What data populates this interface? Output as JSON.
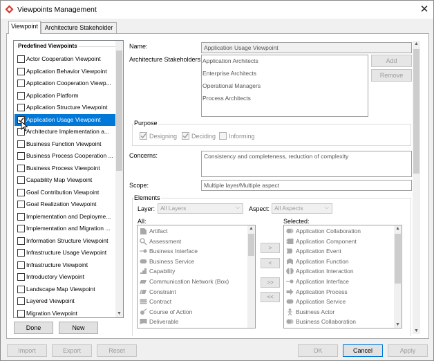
{
  "window": {
    "title": "Viewpoints Management",
    "close_glyph": "✕"
  },
  "tabs": [
    {
      "label": "Viewpoint"
    },
    {
      "label": "Architecture Stakeholder"
    }
  ],
  "predefined": {
    "heading": "Predefined Viewpoints",
    "items": [
      "Actor Cooperation Viewpoint",
      "Application Behavior Viewpoint",
      "Application Cooperation Viewp...",
      "Application Platform",
      "Application Structure Viewpoint",
      "Application Usage Viewpoint",
      "Architecture Implementation a...",
      "Business Function Viewpoint",
      "Business Process Cooperation ...",
      "Business Process Viewpoint",
      "Capability Map Viewpoint",
      "Goal Contribution Viewpoint",
      "Goal Realization Viewpoint",
      "Implementation and Deployme...",
      "Implementation and Migration ...",
      "Information Structure Viewpoint",
      "Infrastructure Usage Viewpoint",
      "Infrastructure Viewpoint",
      "Introductory Viewpoint",
      "Landscape Map Viewpoint",
      "Layered Viewpoint",
      "Migration Viewpoint"
    ],
    "selected_index": 5,
    "done_label": "Done",
    "new_label": "New"
  },
  "form": {
    "name_label": "Name:",
    "name_value": "Application Usage Viewpoint",
    "stakeholders_label": "Architecture Stakeholders:",
    "stakeholders": [
      "Application Architects",
      "Enterprise Architects",
      "Operational Managers",
      "Process Architects"
    ],
    "add_label": "Add",
    "remove_label": "Remove",
    "purpose_label": "Purpose",
    "purpose": [
      {
        "label": "Designing",
        "checked": true
      },
      {
        "label": "Deciding",
        "checked": true
      },
      {
        "label": "Informing",
        "checked": false
      }
    ],
    "concerns_label": "Concerns:",
    "concerns_value": "Consistency and completeness, reduction of complexity",
    "scope_label": "Scope:",
    "scope_value": "Multiple layer/Multiple aspect"
  },
  "elements": {
    "group_label": "Elements",
    "layer_label": "Layer:",
    "layer_value": "All Layers",
    "aspect_label": "Aspect:",
    "aspect_value": "All Aspects",
    "all_label": "All:",
    "selected_label": "Selected:",
    "all": [
      {
        "label": "Artifact",
        "icon": "artifact-icon"
      },
      {
        "label": "Assessment",
        "icon": "assessment-icon"
      },
      {
        "label": "Business Interface",
        "icon": "interface-icon"
      },
      {
        "label": "Business Service",
        "icon": "service-icon"
      },
      {
        "label": "Capability",
        "icon": "capability-icon"
      },
      {
        "label": "Communication Network (Box)",
        "icon": "network-icon"
      },
      {
        "label": "Constraint",
        "icon": "constraint-icon"
      },
      {
        "label": "Contract",
        "icon": "contract-icon"
      },
      {
        "label": "Course of Action",
        "icon": "course-of-action-icon"
      },
      {
        "label": "Deliverable",
        "icon": "deliverable-icon"
      }
    ],
    "selected": [
      {
        "label": "Application Collaboration",
        "icon": "collaboration-icon"
      },
      {
        "label": "Application Component",
        "icon": "component-icon"
      },
      {
        "label": "Application Event",
        "icon": "event-icon"
      },
      {
        "label": "Application Function",
        "icon": "function-icon"
      },
      {
        "label": "Application Interaction",
        "icon": "interaction-icon"
      },
      {
        "label": "Application Interface",
        "icon": "interface-icon"
      },
      {
        "label": "Application Process",
        "icon": "process-icon"
      },
      {
        "label": "Application Service",
        "icon": "service-icon"
      },
      {
        "label": "Business Actor",
        "icon": "actor-icon"
      },
      {
        "label": "Business Collaboration",
        "icon": "collaboration-icon"
      }
    ],
    "move_buttons": [
      ">",
      "<",
      ">>",
      "<<"
    ]
  },
  "footer": {
    "import_label": "Import",
    "export_label": "Export",
    "reset_label": "Reset",
    "ok_label": "OK",
    "cancel_label": "Cancel",
    "apply_label": "Apply"
  },
  "colors": {
    "selection": "#0078d7",
    "icon_fill": "#a8a8a8"
  }
}
